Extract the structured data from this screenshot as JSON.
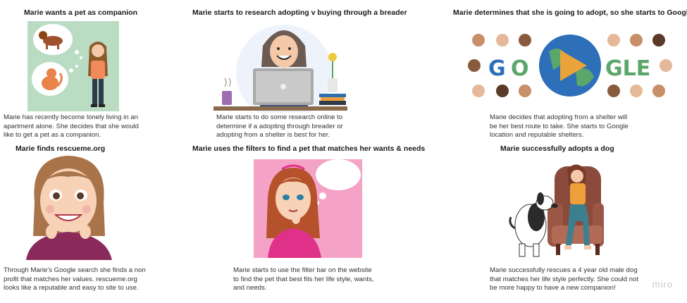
{
  "cards": [
    {
      "title": "Marie wants a pet as companion",
      "image_icon": "girl-thinking-of-dog-and-cat-illustration",
      "lines": [
        " Marie has recently become lonely living in an",
        "apartment alone. She decides that she would",
        "like to get a pet as a companion."
      ]
    },
    {
      "title": "Marie starts to research adopting v buying through a breader",
      "image_icon": "woman-at-laptop-illustration",
      "lines": [
        "Marie starts to do some research online to",
        "determine if a adopting through breader or",
        "adopting from a shelter is best for her."
      ]
    },
    {
      "title": "Marie determines that she is going to adopt, so she starts to Google",
      "image_icon": "google-doodle-logo",
      "logo_text": [
        "G",
        "O",
        "GLE"
      ],
      "lines": [
        "Marie decides that adopting from a shelter will",
        "be her best route to take. She starts to Google",
        "location and reputable shelters."
      ]
    },
    {
      "title": "Marie finds rescueme.org",
      "image_icon": "smiling-girl-illustration",
      "lines": [
        "Through Marie's Google search she finds a non",
        "profit that matches her values.  rescueme.org",
        "looks like a reputable and easy to site to use."
      ]
    },
    {
      "title": "Marie uses the filters to find a pet that matches her wants & needs",
      "image_icon": "girl-with-thought-bubble-illustration",
      "lines": [
        "Marie starts to use the filter bar on the website",
        "to find the pet that best fits her life style, wants,",
        "and needs."
      ]
    },
    {
      "title": "Marie successfully adopts a dog",
      "image_icon": "woman-in-armchair-with-dog-illustration",
      "lines": [
        "Marie successfully rescues a 4 year old male dog",
        "that matches her life style perfectly. She could not",
        "be more happy to have a new companion!"
      ]
    }
  ],
  "watermark": "miro",
  "colors": {
    "mint": "#b9dcc3",
    "pink": "#f4a3c7",
    "doodle_blue": "#2d6fb8",
    "doodle_orange": "#e8a33a",
    "doodle_green": "#5aa66b"
  }
}
